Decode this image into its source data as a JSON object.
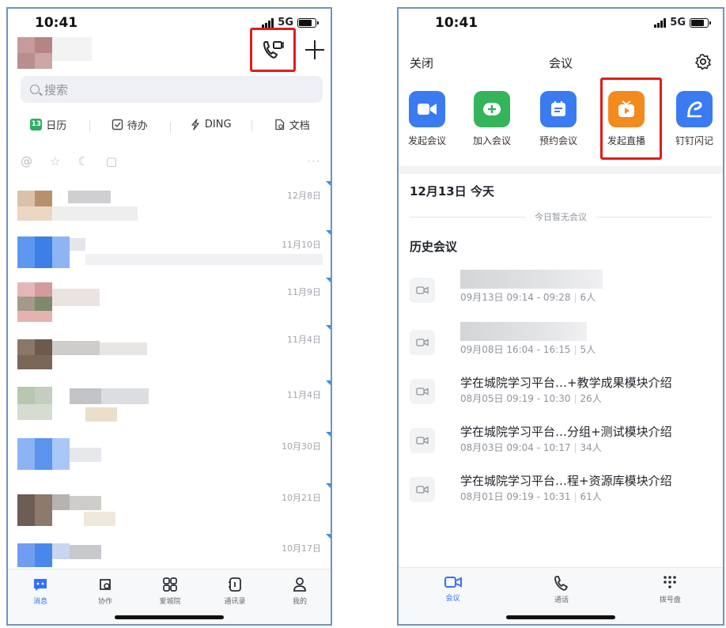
{
  "left": {
    "status": {
      "time": "10:41",
      "network": "5G"
    },
    "search": {
      "placeholder": "搜索"
    },
    "shortcuts": [
      {
        "label": "日历",
        "icon": "calendar-icon",
        "badge": "13"
      },
      {
        "label": "待办",
        "icon": "todo-check-icon"
      },
      {
        "label": "DING",
        "icon": "ding-bolt-icon"
      },
      {
        "label": "文档",
        "icon": "document-icon"
      }
    ],
    "filters": [
      "@",
      "☆",
      "☾",
      "▢"
    ],
    "filters_more": "···",
    "chats": [
      {
        "date": "12月8日"
      },
      {
        "date": "11月10日"
      },
      {
        "date": "11月9日"
      },
      {
        "date": "11月4日"
      },
      {
        "date": "11月4日"
      },
      {
        "date": "10月30日"
      },
      {
        "date": "10月21日"
      },
      {
        "date": "10月17日"
      }
    ],
    "tabs": [
      {
        "label": "消息",
        "icon": "message-icon",
        "active": true
      },
      {
        "label": "协作",
        "icon": "collab-icon"
      },
      {
        "label": "爱城院",
        "icon": "apps-grid-icon"
      },
      {
        "label": "通讯录",
        "icon": "contacts-icon"
      },
      {
        "label": "我的",
        "icon": "profile-icon"
      }
    ]
  },
  "right": {
    "status": {
      "time": "10:41",
      "network": "5G"
    },
    "nav": {
      "close": "关闭",
      "title": "会议"
    },
    "actions": [
      {
        "label": "发起会议",
        "icon": "video-camera-icon",
        "color": "#3a7bf2"
      },
      {
        "label": "加入会议",
        "icon": "join-plus-icon",
        "color": "#35b45a"
      },
      {
        "label": "预约会议",
        "icon": "schedule-icon",
        "color": "#3a7bf2"
      },
      {
        "label": "发起直播",
        "icon": "live-tv-icon",
        "color": "#f28a1e"
      },
      {
        "label": "钉钉闪记",
        "icon": "flash-note-icon",
        "color": "#3a7bf2"
      }
    ],
    "today": {
      "title": "12月13日 今天",
      "empty": "今日暂无会议"
    },
    "history": {
      "title": "历史会议",
      "items": [
        {
          "title": "",
          "time": "09月13日 09:14 - 09:28",
          "count": "6人"
        },
        {
          "title": "",
          "time": "09月08日 16:04 - 16:15",
          "count": "5人"
        },
        {
          "title": "学在城院学习平台…+教学成果模块介绍",
          "time": "08月05日 09:19 - 10:30",
          "count": "26人"
        },
        {
          "title": "学在城院学习平台…分组+测试模块介绍",
          "time": "08月03日 09:04 - 10:17",
          "count": "34人"
        },
        {
          "title": "学在城院学习平台…程+资源库模块介绍",
          "time": "08月01日 09:19 - 10:31",
          "count": "61人"
        }
      ]
    },
    "tabs": [
      {
        "label": "会议",
        "icon": "video-camera-icon",
        "active": true
      },
      {
        "label": "通话",
        "icon": "phone-icon"
      },
      {
        "label": "拨号盘",
        "icon": "dialpad-icon"
      }
    ]
  },
  "colors": {
    "accent": "#3370ff",
    "highlight": "#e21b1b",
    "live": "#f28a1e",
    "green": "#35b45a"
  }
}
